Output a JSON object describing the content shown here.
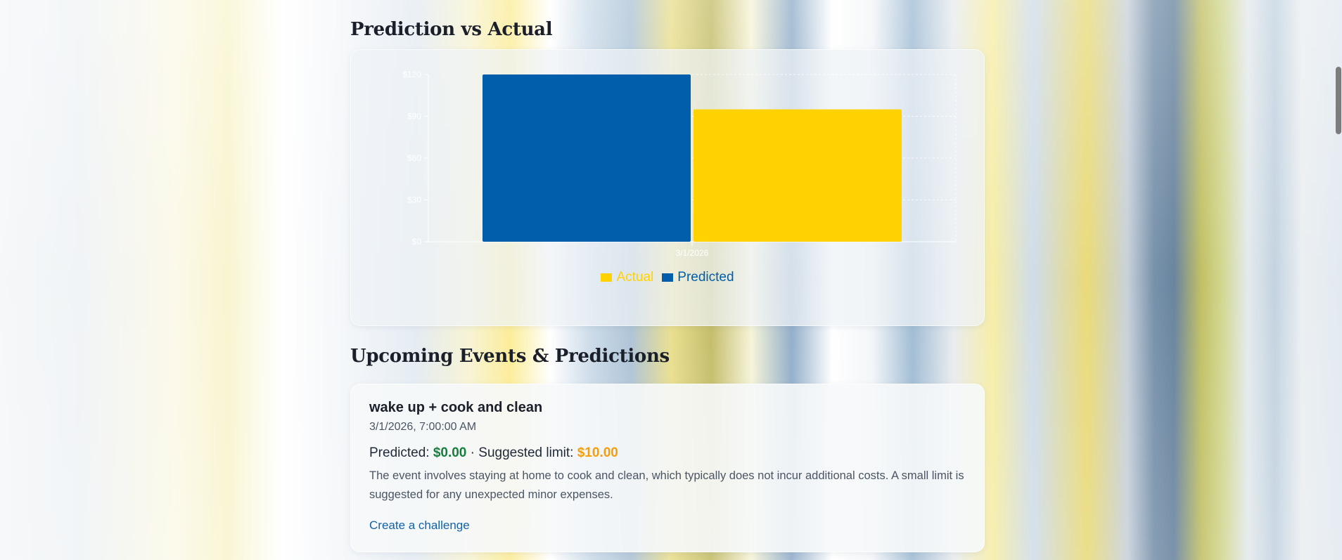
{
  "colors": {
    "actual": "#FFD200",
    "predicted": "#005EAA",
    "predicted_amount": "#15803d",
    "suggested_limit": "#f59e0b",
    "link": "#1461a8"
  },
  "prediction_section": {
    "title": "Prediction vs Actual"
  },
  "chart_data": {
    "type": "bar",
    "categories": [
      "3/1/2026"
    ],
    "series": [
      {
        "name": "Predicted",
        "values": [
          120
        ],
        "color": "#005EAA"
      },
      {
        "name": "Actual",
        "values": [
          95
        ],
        "color": "#FFD200"
      }
    ],
    "y_ticks": [
      "$0",
      "$30",
      "$60",
      "$90",
      "$120"
    ],
    "ylim": [
      0,
      120
    ],
    "legend": [
      "Actual",
      "Predicted"
    ],
    "legend_position": "bottom",
    "grid": true
  },
  "events_section": {
    "title": "Upcoming Events & Predictions",
    "events": [
      {
        "title": "wake up + cook and clean",
        "datetime": "3/1/2026, 7:00:00 AM",
        "predicted_label": "Predicted:",
        "predicted_value": "$0.00",
        "separator": " · ",
        "limit_label": "Suggested limit:",
        "limit_value": "$10.00",
        "description": "The event involves staying at home to cook and clean, which typically does not incur additional costs. A small limit is suggested for any unexpected minor expenses.",
        "action_label": "Create a challenge"
      }
    ]
  }
}
